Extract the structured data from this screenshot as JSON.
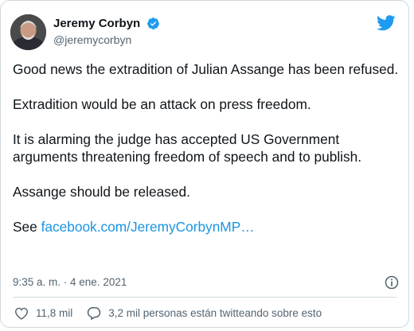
{
  "author": {
    "display_name": "Jeremy Corbyn",
    "handle": "@jeremycorbyn"
  },
  "tweet": {
    "paragraphs": [
      "Good news the extradition of Julian Assange has been refused.",
      "Extradition would be an attack on press freedom.",
      "It is alarming the judge has accepted US Government arguments threatening freedom of speech and to publish.",
      "Assange should be released."
    ],
    "link_prefix": "See ",
    "link_text": "facebook.com/JeremyCorbynMP…",
    "timestamp": "9:35 a. m. · 4 ene. 2021"
  },
  "actions": {
    "likes": "11,8 mil",
    "conversation": "3,2 mil personas están twitteando sobre esto"
  },
  "colors": {
    "accent": "#1d9bf0",
    "link": "#1b95e0",
    "secondary_text": "#536471",
    "border": "#cfd9de"
  },
  "icons": [
    "avatar",
    "verified-badge-icon",
    "twitter-bird-icon",
    "info-icon",
    "heart-icon",
    "speech-bubble-icon"
  ]
}
